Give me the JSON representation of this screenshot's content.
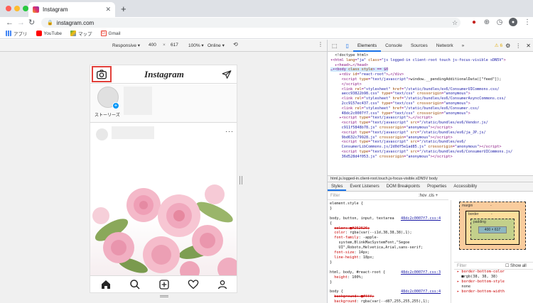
{
  "browser": {
    "tab_title": "Instagram",
    "new_tab": "+",
    "url": "instagram.com"
  },
  "bookmarks": [
    {
      "label": "アプリ",
      "color": "#4285f4"
    },
    {
      "label": "YouTube",
      "color": "#ff0000"
    },
    {
      "label": "マップ",
      "color": "#34a853"
    },
    {
      "label": "Gmail",
      "color": "#ea4335"
    }
  ],
  "device_toolbar": {
    "device": "Responsive ▾",
    "width": "400",
    "times": "×",
    "height": "617",
    "zoom": "100% ▾",
    "network": "Online ▾"
  },
  "instagram": {
    "logo": "Instagram",
    "story_label": "ストーリーズ",
    "more": "···"
  },
  "devtools": {
    "tabs": [
      "Elements",
      "Console",
      "Sources",
      "Network",
      "»"
    ],
    "warnings": "⚠ 6",
    "breadcrumb": "html.js.logged-in.client-root.touch.js-focus-visible.sDN5V   body",
    "sub_tabs": [
      "Styles",
      "Event Listeners",
      "DOM Breakpoints",
      "Properties",
      "Accessibility"
    ],
    "filter_placeholder": "Filter",
    "filter_right": ":hov  .cls  +",
    "box_model": {
      "margin": "margin",
      "border": "border",
      "padding": "padding",
      "content": "400 × 617",
      "dash": "-"
    },
    "computed_filter": "Filter",
    "show_all": "Show all"
  }
}
